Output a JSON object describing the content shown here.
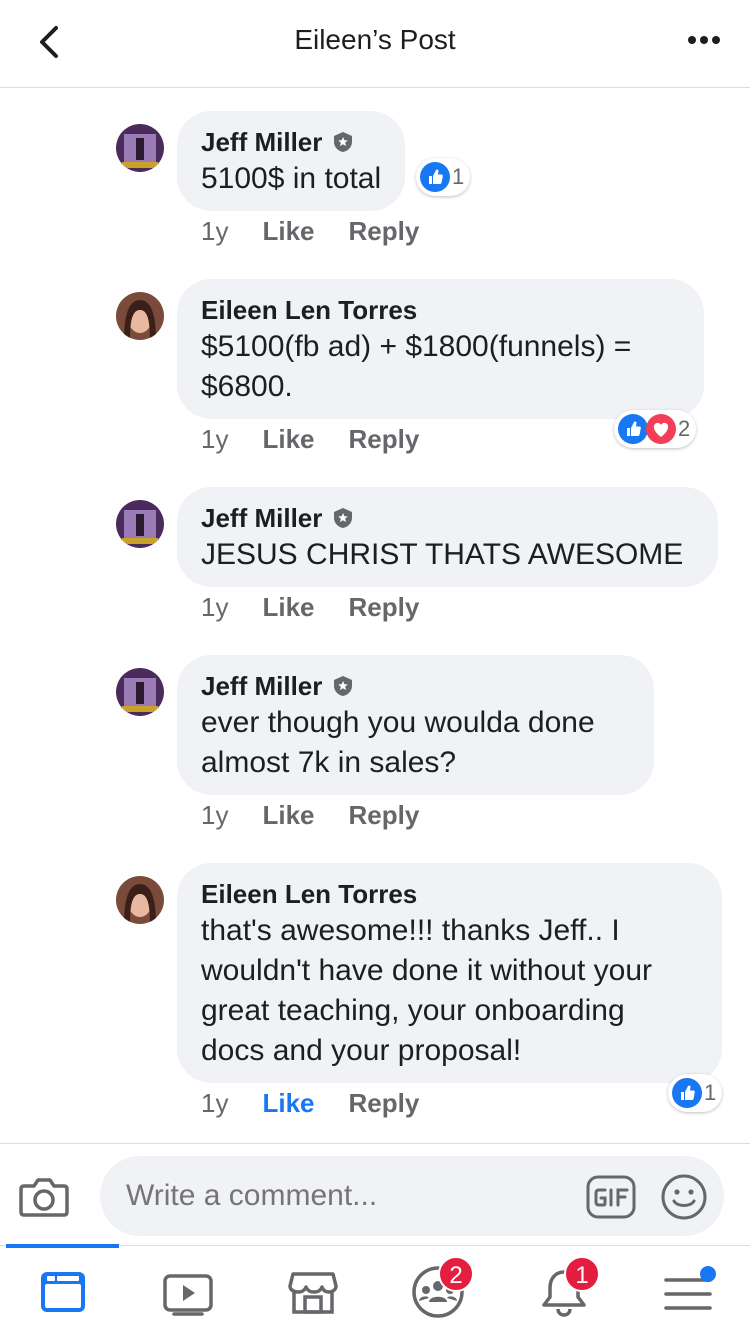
{
  "header": {
    "title": "Eileen’s Post"
  },
  "comments": [
    {
      "author": "Jeff Miller",
      "text": "5100$ in total",
      "time": "1y",
      "like": "Like",
      "reply": "Reply",
      "reaction_count": "1"
    },
    {
      "author": "Eileen Len Torres",
      "text_line1": "$5100(fb ad) + $1800(funnels) =",
      "text_line2": "$6800.",
      "time": "1y",
      "like": "Like",
      "reply": "Reply",
      "reaction_count": "2"
    },
    {
      "author": "Jeff Miller",
      "text": "JESUS CHRIST THATS AWESOME",
      "time": "1y",
      "like": "Like",
      "reply": "Reply"
    },
    {
      "author": "Jeff Miller",
      "text_line1": "ever though you woulda done",
      "text_line2": "almost 7k in sales?",
      "time": "1y",
      "like": "Like",
      "reply": "Reply"
    },
    {
      "author": "Eileen Len Torres",
      "text_line1": "that's awesome!!! thanks Jeff.. I",
      "text_line2": "wouldn't have done it without your",
      "text_line3": "great teaching, your onboarding",
      "text_line4": "docs and your proposal!",
      "time": "1y",
      "like": "Like",
      "reply": "Reply",
      "reaction_count": "1"
    }
  ],
  "composer": {
    "placeholder": "Write a comment..."
  },
  "tabbar": {
    "groups_badge": "2",
    "notifications_badge": "1"
  },
  "colors": {
    "accent": "#1877f2",
    "bubble": "#f0f2f5",
    "badge_red": "#e41e3f",
    "meta_gray": "#65676b"
  }
}
